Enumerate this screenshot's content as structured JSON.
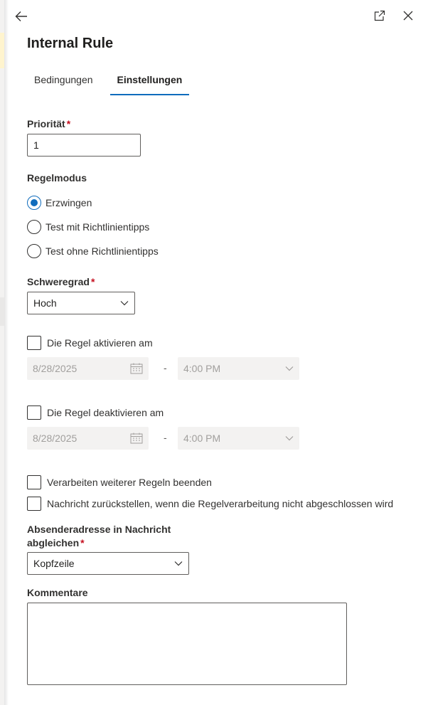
{
  "panel": {
    "title": "Internal Rule"
  },
  "tabs": [
    {
      "label": "Bedingungen",
      "active": false
    },
    {
      "label": "Einstellungen",
      "active": true
    }
  ],
  "priority": {
    "label": "Priorität",
    "required_mark": "*",
    "value": "1"
  },
  "rule_mode": {
    "label": "Regelmodus",
    "options": [
      {
        "label": "Erzwingen",
        "selected": true
      },
      {
        "label": "Test mit Richtlinientipps",
        "selected": false
      },
      {
        "label": "Test ohne Richtlinientipps",
        "selected": false
      }
    ]
  },
  "severity": {
    "label": "Schweregrad",
    "required_mark": "*",
    "value": "Hoch"
  },
  "activate": {
    "label": "Die Regel aktivieren am",
    "checked": false,
    "date": "8/28/2025",
    "separator": "-",
    "time": "4:00 PM"
  },
  "deactivate": {
    "label": "Die Regel deaktivieren am",
    "checked": false,
    "date": "8/28/2025",
    "separator": "-",
    "time": "4:00 PM"
  },
  "stop_processing": {
    "label": "Verarbeiten weiterer Regeln beenden",
    "checked": false
  },
  "defer_message": {
    "label": "Nachricht zurückstellen, wenn die Regelverarbeitung nicht abgeschlossen wird",
    "checked": false
  },
  "sender_match": {
    "label_line1": "Absenderadresse in Nachricht",
    "label_line2": "abgleichen",
    "required_mark": "*",
    "value": "Kopfzeile"
  },
  "comments": {
    "label": "Kommentare",
    "value": ""
  },
  "colors": {
    "accent": "#0f6cbd",
    "required": "#c50f1f",
    "disabled_bg": "#f3f2f1",
    "disabled_text": "#a19f9d"
  },
  "icons": [
    "back-arrow-icon",
    "popout-icon",
    "close-icon",
    "calendar-icon",
    "chevron-down-icon"
  ]
}
